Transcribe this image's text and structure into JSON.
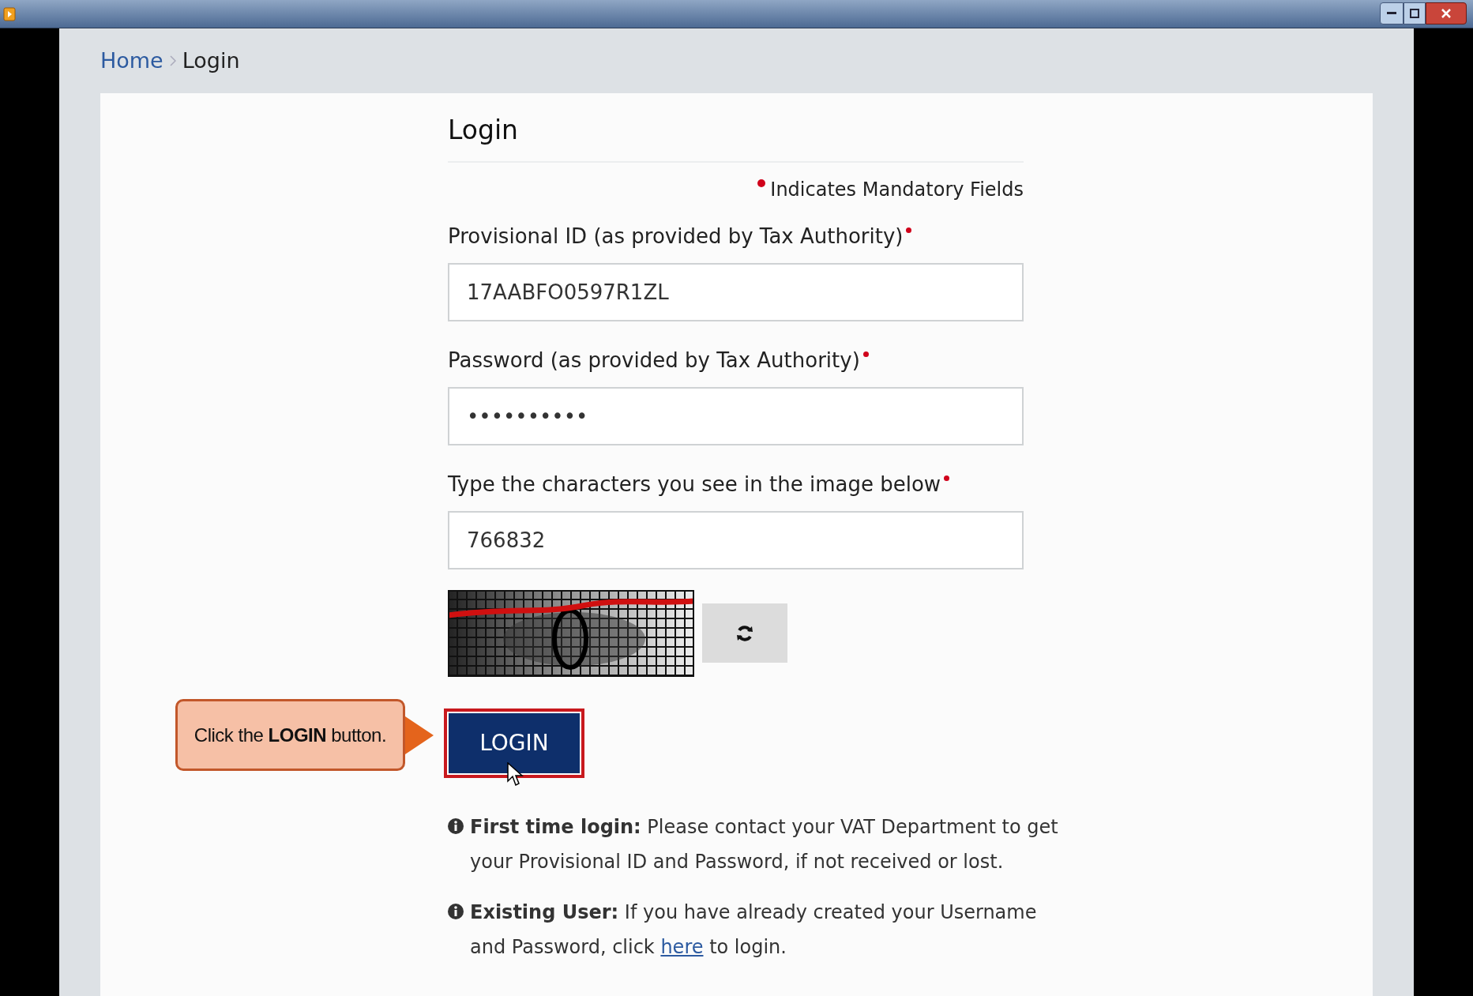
{
  "breadcrumb": [
    "Home",
    "Login"
  ],
  "heading": "Login",
  "mandatory_note": "Indicates Mandatory Fields",
  "fields": [
    {
      "label": "Provisional ID (as provided by Tax Authority)",
      "required": true,
      "value": "17AABFO0597R1ZL"
    },
    {
      "label": "Password (as provided by Tax Authority)",
      "required": true,
      "value": "••••••••••"
    },
    {
      "label": "Type the characters you see in the image below",
      "required": true,
      "value": "766832"
    }
  ],
  "captcha": {
    "kind": "picture"
  },
  "login_button": "LOGIN",
  "callout": "Click the **LOGIN** button.",
  "first_time": "**First time login:** Please contact your VAT Department to get your Provisional ID and Password, if not received or lost.",
  "existing_user": {
    "before": "**Existing User:** If you have already created your Username and Password, click ",
    "link": "here",
    "after": " to login."
  }
}
